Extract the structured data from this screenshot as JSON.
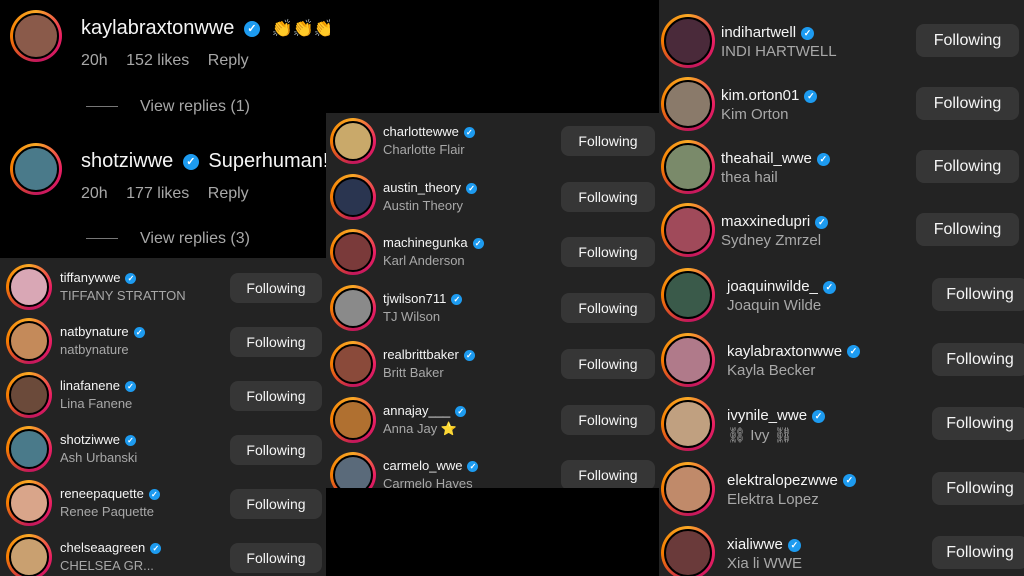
{
  "comments": [
    {
      "handle": "kaylabraxtonwwe",
      "text": "👏👏👏",
      "time": "20h",
      "likes": "152 likes",
      "reply": "Reply",
      "view_replies": "View replies (1)"
    },
    {
      "handle": "shotziwwe",
      "text": "Superhuman!",
      "time": "20h",
      "likes": "177 likes",
      "reply": "Reply",
      "view_replies": "View replies (3)"
    }
  ],
  "following_label": "Following",
  "check_glyph": "✓",
  "left_list": [
    {
      "handle": "tiffanywwe",
      "name": "TIFFANY STRATTON",
      "color": "#d9a7b5"
    },
    {
      "handle": "natbynature",
      "name": "natbynature",
      "color": "#c48a5a"
    },
    {
      "handle": "linafanene",
      "name": "Lina Fanene",
      "color": "#6b4a3a"
    },
    {
      "handle": "shotziwwe",
      "name": "Ash Urbanski",
      "color": "#4a7a8a"
    },
    {
      "handle": "reneepaquette",
      "name": "Renee Paquette",
      "color": "#d9a58a"
    },
    {
      "handle": "chelseaagreen",
      "name": "CHELSEA GR...",
      "color": "#c9a070"
    }
  ],
  "middle_list": [
    {
      "handle": "charlottewwe",
      "name": "Charlotte Flair",
      "color": "#c9a96a"
    },
    {
      "handle": "austin_theory",
      "name": "Austin Theory",
      "color": "#2a3550"
    },
    {
      "handle": "machinegunka",
      "name": "Karl Anderson",
      "color": "#7a3a3a"
    },
    {
      "handle": "tjwilson711",
      "name": "TJ Wilson",
      "color": "#8a8a8a"
    },
    {
      "handle": "realbrittbaker",
      "name": "Britt Baker",
      "color": "#8a4a3a"
    },
    {
      "handle": "annajay___",
      "name": "Anna Jay ⭐",
      "color": "#b07030"
    },
    {
      "handle": "carmelo_wwe",
      "name": "Carmelo Hayes",
      "color": "#5a6a7a"
    }
  ],
  "right_list": [
    {
      "handle": "indihartwell",
      "name": "INDI HARTWELL",
      "color": "#4a2a3a"
    },
    {
      "handle": "kim.orton01",
      "name": "Kim Orton",
      "color": "#8a7a6a"
    },
    {
      "handle": "theahail_wwe",
      "name": "thea hail",
      "color": "#7a8a6a"
    },
    {
      "handle": "maxxinedupri",
      "name": "Sydney Zmrzel",
      "color": "#a04a5a"
    },
    {
      "handle": "joaquinwilde_",
      "name": "Joaquin Wilde",
      "color": "#3a5a4a"
    },
    {
      "handle": "kaylabraxtonwwe",
      "name": "Kayla Becker",
      "color": "#b07a8a"
    },
    {
      "handle": "ivynile_wwe",
      "name": "⛓ Ivy ⛓",
      "color": "#c0a080"
    },
    {
      "handle": "elektralopezwwe",
      "name": "Elektra Lopez",
      "color": "#c08a6a"
    },
    {
      "handle": "xialiwwe",
      "name": "Xia li WWE",
      "color": "#6a3a3a"
    }
  ]
}
